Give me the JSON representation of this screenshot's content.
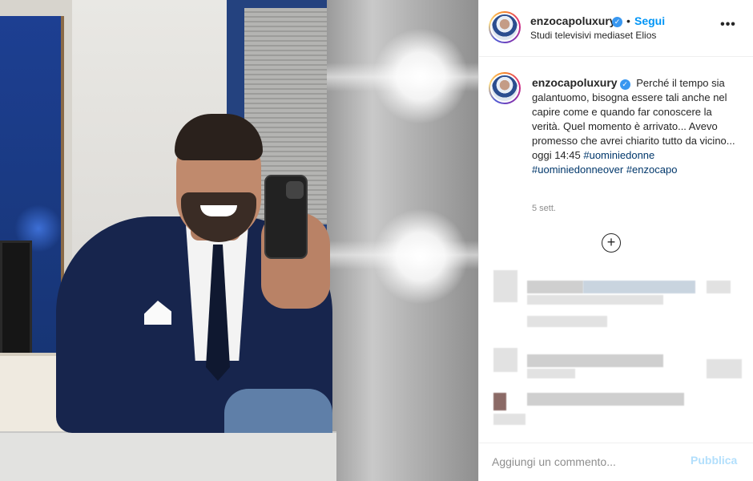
{
  "post": {
    "username": "enzocapoluxury",
    "verified_mark": "✓",
    "follow_label": "Segui",
    "separator": "•",
    "location": "Studi televisivi mediaset Elios",
    "more_icon": "•••",
    "caption_text": "Perché il tempo sia galantuomo, bisogna essere tali anche nel capire come e quando far conoscere la verità. Quel momento è arrivato... Avevo promesso che avrei chiarito tutto da vicino... oggi 14:45",
    "hashtags": [
      "#uominiedonne",
      "#uominiedonneover",
      "#enzocapo"
    ],
    "time_ago": "5 sett.",
    "load_more_icon": "+"
  },
  "comment_bar": {
    "placeholder": "Aggiungi un commento...",
    "publish_label": "Pubblica"
  },
  "colors": {
    "follow": "#0095f6",
    "verified": "#3897f0",
    "publish_disabled": "#b2dffc",
    "hashtag": "#00376b"
  },
  "icons": [
    "verified-badge-icon",
    "more-options-icon",
    "load-more-comments-icon"
  ]
}
